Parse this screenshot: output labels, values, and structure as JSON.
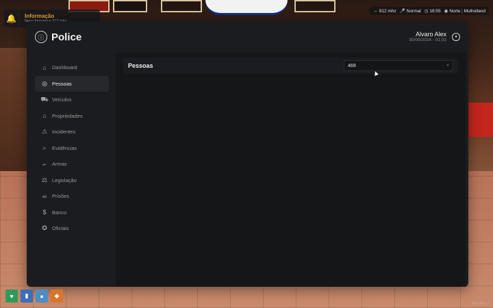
{
  "notification": {
    "title": "Informação",
    "message": "Nova fréquence 912 mhz"
  },
  "hud": {
    "radio": "912 mhz",
    "voice": "Normal",
    "time": "18:55",
    "direction": "Norte",
    "location": "Mulholland"
  },
  "app": {
    "title": "Police",
    "user_name": "Alvaro Alex",
    "user_datetime": "30/09/2024 - 01:03"
  },
  "sidebar": {
    "items": [
      {
        "label": "Dashboard",
        "icon": "home-icon"
      },
      {
        "label": "Pessoas",
        "icon": "user-circle-icon",
        "active": true
      },
      {
        "label": "Veículos",
        "icon": "car-icon"
      },
      {
        "label": "Propriedades",
        "icon": "house-icon"
      },
      {
        "label": "Incidentes",
        "icon": "warning-icon"
      },
      {
        "label": "Evidências",
        "icon": "search-icon"
      },
      {
        "label": "Armas",
        "icon": "gun-icon"
      },
      {
        "label": "Legislação",
        "icon": "gavel-icon"
      },
      {
        "label": "Prisões",
        "icon": "handcuffs-icon"
      },
      {
        "label": "Banco",
        "icon": "dollar-icon"
      },
      {
        "label": "Oficiais",
        "icon": "badge-icon"
      }
    ]
  },
  "content": {
    "title": "Pessoas",
    "search_value": "469"
  },
  "status": {
    "health": "heart-icon",
    "armor": "vest-icon",
    "water": "drop-icon",
    "food": "food-icon"
  },
  "watermark": "NTEXA 1.0"
}
